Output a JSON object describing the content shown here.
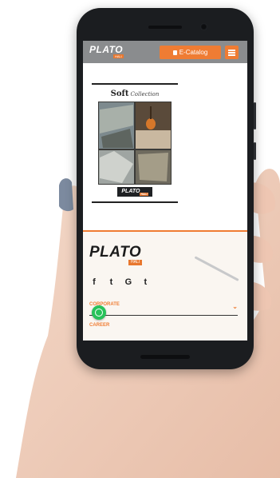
{
  "header": {
    "logo_text": "PLATO",
    "logo_tag": "HALI",
    "ecatalog_label": "E-Catalog",
    "menu_icon": "hamburger-icon"
  },
  "catalog": {
    "title": "Soft",
    "title_script": "Collection",
    "brand_text": "PLATO",
    "brand_tag": "HALI"
  },
  "footer": {
    "logo_text": "PLATO",
    "logo_tag": "HALI",
    "socials": [
      "f",
      "t",
      "G",
      "t"
    ],
    "sections": [
      "CORPORATE",
      "CAREER"
    ]
  },
  "colors": {
    "accent": "#ef7c33",
    "topbar": "#8a8c8e",
    "whatsapp": "#27c25a"
  }
}
